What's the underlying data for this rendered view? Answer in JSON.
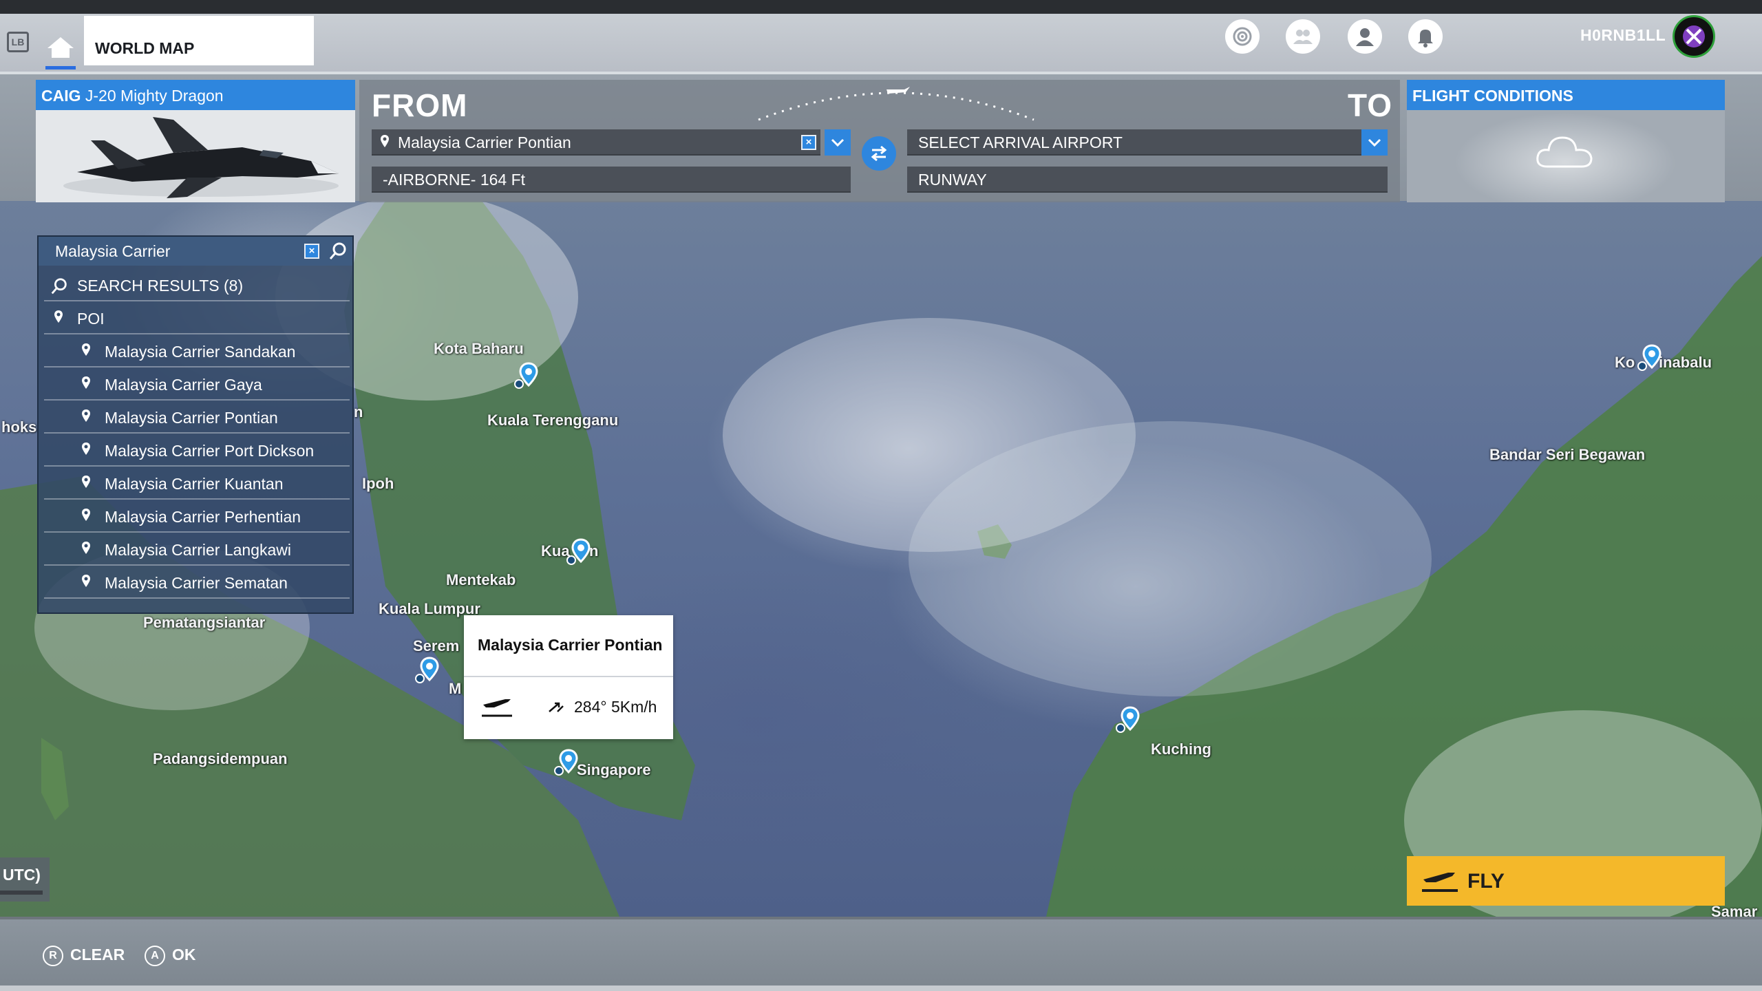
{
  "topbar": {
    "lb_label": "LB",
    "tab_label": "WORLD MAP",
    "username": "H0RNB1LL",
    "accent": "#2e86de"
  },
  "aircraft": {
    "brand": "CAIG",
    "model": "J-20 Mighty Dragon"
  },
  "route": {
    "from_label": "FROM",
    "to_label": "TO",
    "departure": "Malaysia Carrier Pontian",
    "departure_clear": "×",
    "departure_detail": "-AIRBORNE- 164 Ft",
    "arrival_placeholder": "SELECT ARRIVAL AIRPORT",
    "arrival_detail": "RUNWAY"
  },
  "flight_conditions": {
    "title": "FLIGHT CONDITIONS",
    "icon": "cloud-icon"
  },
  "search": {
    "query": "Malaysia Carrier",
    "clear": "×",
    "results_label": "SEARCH RESULTS (8)",
    "category": "POI",
    "results": [
      "Malaysia Carrier Sandakan",
      "Malaysia Carrier Gaya",
      "Malaysia Carrier Pontian",
      "Malaysia Carrier Port Dickson",
      "Malaysia Carrier Kuantan",
      "Malaysia Carrier Perhentian",
      "Malaysia Carrier Langkawi",
      "Malaysia Carrier Sematan"
    ]
  },
  "map": {
    "cities": {
      "kota_baharu": "Kota Baharu",
      "kuala_terengganu": "Kuala Terengganu",
      "ipoh": "Ipoh",
      "kuantan_left": "Kua",
      "kuantan_right": "n",
      "mentekab": "Mentekab",
      "kuala_lumpur": "Kuala Lumpur",
      "pematangsiantar": "Pematangsiantar",
      "seremban": "Serem",
      "m_fragment": "M",
      "singapore": "Singapore",
      "padangsidempuan": "Padangsidempuan",
      "kuching": "Kuching",
      "kota_kinabalu_left": "Ko",
      "kota_kinabalu_right": "inabalu",
      "bandar_seri_begawan": "Bandar Seri Begawan",
      "samar": "Samar",
      "hoks": "hoks",
      "n_fragment": "n"
    },
    "popup": {
      "title": "Malaysia Carrier Pontian",
      "wind": "284° 5Km/h"
    },
    "utc_label": "UTC)"
  },
  "actions": {
    "fly": "FLY",
    "fly_color": "#f4b82a",
    "clear_key": "R",
    "clear_label": "CLEAR",
    "ok_key": "A",
    "ok_label": "OK"
  }
}
